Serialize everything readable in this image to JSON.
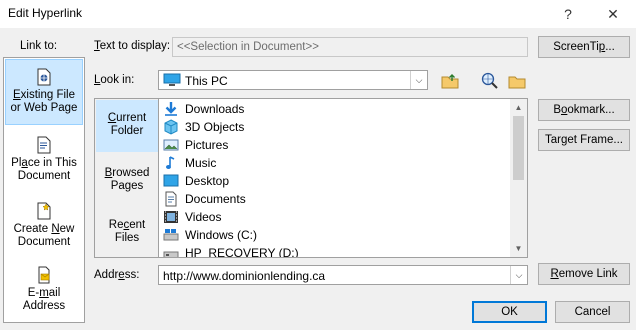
{
  "window": {
    "title": "Edit Hyperlink",
    "help_glyph": "?",
    "close_glyph": "✕"
  },
  "link_to": {
    "label": "Link to:",
    "items": [
      {
        "label_a": "E",
        "label_b": "xisting File",
        "label_c": "or Web Page",
        "icon": "existing-file-icon"
      },
      {
        "label_a": "Pl",
        "label_b": "a",
        "label_c": "ce in This",
        "label_d": "Document",
        "icon": "place-in-document-icon"
      },
      {
        "label_a": "Create ",
        "label_b": "N",
        "label_c": "ew",
        "label_d": "Document",
        "icon": "create-new-document-icon"
      },
      {
        "label_a": "E-",
        "label_b": "m",
        "label_c": "ail",
        "label_d": "Address",
        "icon": "email-address-icon"
      }
    ]
  },
  "text_to_display": {
    "label_a": "",
    "label_u": "T",
    "label_b": "ext to display:",
    "value": "<<Selection in Document>>"
  },
  "screentip_button": {
    "label_a": "ScreenTi",
    "label_u": "p",
    "label_b": "..."
  },
  "look_in": {
    "label_a": "",
    "label_u": "L",
    "label_b": "ook in:",
    "value": "This PC",
    "icon": "this-pc-icon"
  },
  "toolbar": {
    "up_folder_icon": "up-folder-icon",
    "browse_web_icon": "browse-web-icon",
    "browse_file_icon": "browse-file-icon"
  },
  "sidebar2": {
    "items": [
      {
        "label_a": "C",
        "label_b": "urrent",
        "label_c": "Folder"
      },
      {
        "label_a": "",
        "label_u": "B",
        "label_b": "rowsed",
        "label_c": "Pages"
      },
      {
        "label_a": "Re",
        "label_u": "c",
        "label_b": "ent",
        "label_c": "Files"
      }
    ]
  },
  "files": [
    {
      "name": "Downloads",
      "icon": "downloads-icon"
    },
    {
      "name": "3D Objects",
      "icon": "3d-objects-icon"
    },
    {
      "name": "Pictures",
      "icon": "pictures-icon"
    },
    {
      "name": "Music",
      "icon": "music-icon"
    },
    {
      "name": "Desktop",
      "icon": "desktop-icon"
    },
    {
      "name": "Documents",
      "icon": "documents-icon"
    },
    {
      "name": "Videos",
      "icon": "videos-icon"
    },
    {
      "name": "Windows  (C:)",
      "icon": "drive-c-icon"
    },
    {
      "name": "HP_RECOVERY (D:)",
      "icon": "drive-d-icon"
    }
  ],
  "right_buttons": {
    "bookmark": {
      "label_a": "B",
      "label_u": "o",
      "label_b": "okmark..."
    },
    "target_frame": {
      "label_a": "Tar",
      "label_u": "g",
      "label_b": "et Frame..."
    },
    "remove_link": {
      "label_a": "",
      "label_u": "R",
      "label_b": "emove Link"
    }
  },
  "address": {
    "label_a": "Addr",
    "label_u": "e",
    "label_b": "ss:",
    "value": "http://www.dominionlending.ca"
  },
  "ok_label": "OK",
  "cancel_label": "Cancel",
  "colors": {
    "accent": "#0078d7",
    "selection": "#cce8ff"
  }
}
